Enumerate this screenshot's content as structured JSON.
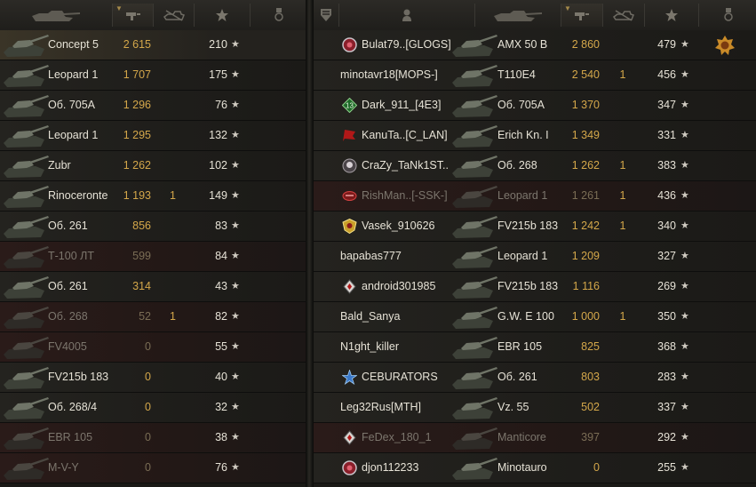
{
  "left_team": [
    {
      "tank": "Concept 5",
      "damage": "2 615",
      "frags": "",
      "exp": "210",
      "dead": false,
      "me": true
    },
    {
      "tank": "Leopard 1",
      "damage": "1 707",
      "frags": "",
      "exp": "175",
      "dead": false
    },
    {
      "tank": "Об. 705А",
      "damage": "1 296",
      "frags": "",
      "exp": "76",
      "dead": false
    },
    {
      "tank": "Leopard 1",
      "damage": "1 295",
      "frags": "",
      "exp": "132",
      "dead": false
    },
    {
      "tank": "Zubr",
      "damage": "1 262",
      "frags": "",
      "exp": "102",
      "dead": false
    },
    {
      "tank": "Rinoceronte",
      "damage": "1 193",
      "frags": "1",
      "exp": "149",
      "dead": false
    },
    {
      "tank": "Об. 261",
      "damage": "856",
      "frags": "",
      "exp": "83",
      "dead": false
    },
    {
      "tank": "Т-100 ЛТ",
      "damage": "599",
      "frags": "",
      "exp": "84",
      "dead": true
    },
    {
      "tank": "Об. 261",
      "damage": "314",
      "frags": "",
      "exp": "43",
      "dead": false
    },
    {
      "tank": "Об. 268",
      "damage": "52",
      "frags": "1",
      "exp": "82",
      "dead": true
    },
    {
      "tank": "FV4005",
      "damage": "0",
      "frags": "",
      "exp": "55",
      "dead": true
    },
    {
      "tank": "FV215b 183",
      "damage": "0",
      "frags": "",
      "exp": "40",
      "dead": false
    },
    {
      "tank": "Об. 268/4",
      "damage": "0",
      "frags": "",
      "exp": "32",
      "dead": false
    },
    {
      "tank": "EBR 105",
      "damage": "0",
      "frags": "",
      "exp": "38",
      "dead": true
    },
    {
      "tank": "M-V-Y",
      "damage": "0",
      "frags": "",
      "exp": "76",
      "dead": true
    }
  ],
  "right_team": [
    {
      "player": "Bulat79..[GLOGS]",
      "badge": "red-circle",
      "tank": "AMX 50 B",
      "damage": "2 860",
      "frags": "",
      "exp": "479",
      "dead": false,
      "medal": true
    },
    {
      "player": "minotavr18[MOPS-]",
      "badge": "",
      "tank": "T110E4",
      "damage": "2 540",
      "frags": "1",
      "exp": "456",
      "dead": false
    },
    {
      "player": "Dark_911_[4E3]",
      "badge": "green-13",
      "tank": "Об. 705А",
      "damage": "1 370",
      "frags": "",
      "exp": "347",
      "dead": false
    },
    {
      "player": "KanuTa..[C_LAN]",
      "badge": "red-flag",
      "tank": "Erich Kn. I",
      "damage": "1 349",
      "frags": "",
      "exp": "331",
      "dead": false
    },
    {
      "player": "CraZy_TaNk1ST..",
      "badge": "skull",
      "tank": "Об. 268",
      "damage": "1 262",
      "frags": "1",
      "exp": "383",
      "dead": false
    },
    {
      "player": "RishMan..[-SSK-]",
      "badge": "red-emblem",
      "tank": "Leopard 1",
      "damage": "1 261",
      "frags": "1",
      "exp": "436",
      "dead": true
    },
    {
      "player": "Vasek_910626",
      "badge": "gold-shield",
      "tank": "FV215b 183",
      "damage": "1 242",
      "frags": "1",
      "exp": "340",
      "dead": false
    },
    {
      "player": "bapabas777",
      "badge": "",
      "tank": "Leopard 1",
      "damage": "1 209",
      "frags": "",
      "exp": "327",
      "dead": false
    },
    {
      "player": "android301985",
      "badge": "diamond",
      "tank": "FV215b 183",
      "damage": "1 116",
      "frags": "",
      "exp": "269",
      "dead": false
    },
    {
      "player": "Bald_Sanya",
      "badge": "",
      "tank": "G.W. E 100",
      "damage": "1 000",
      "frags": "1",
      "exp": "350",
      "dead": false
    },
    {
      "player": "N1ght_killer",
      "badge": "",
      "tank": "EBR 105",
      "damage": "825",
      "frags": "",
      "exp": "368",
      "dead": false
    },
    {
      "player": "CEBURATORS",
      "badge": "blue-star",
      "tank": "Об. 261",
      "damage": "803",
      "frags": "",
      "exp": "283",
      "dead": false
    },
    {
      "player": "Leg32Rus[MTH]",
      "badge": "",
      "tank": "Vz. 55",
      "damage": "502",
      "frags": "",
      "exp": "337",
      "dead": false
    },
    {
      "player": "FeDex_180_1",
      "badge": "diamond",
      "tank": "Manticore",
      "damage": "397",
      "frags": "",
      "exp": "292",
      "dead": true
    },
    {
      "player": "djon112233",
      "badge": "red-circle",
      "tank": "Minotauro",
      "damage": "0",
      "frags": "",
      "exp": "255",
      "dead": false
    }
  ],
  "star_symbol": "★",
  "colors": {
    "damage": "#d4a74a",
    "text": "#e6e2d6",
    "dead_text": "#7c766d",
    "dead_row": "#2a1b19"
  }
}
